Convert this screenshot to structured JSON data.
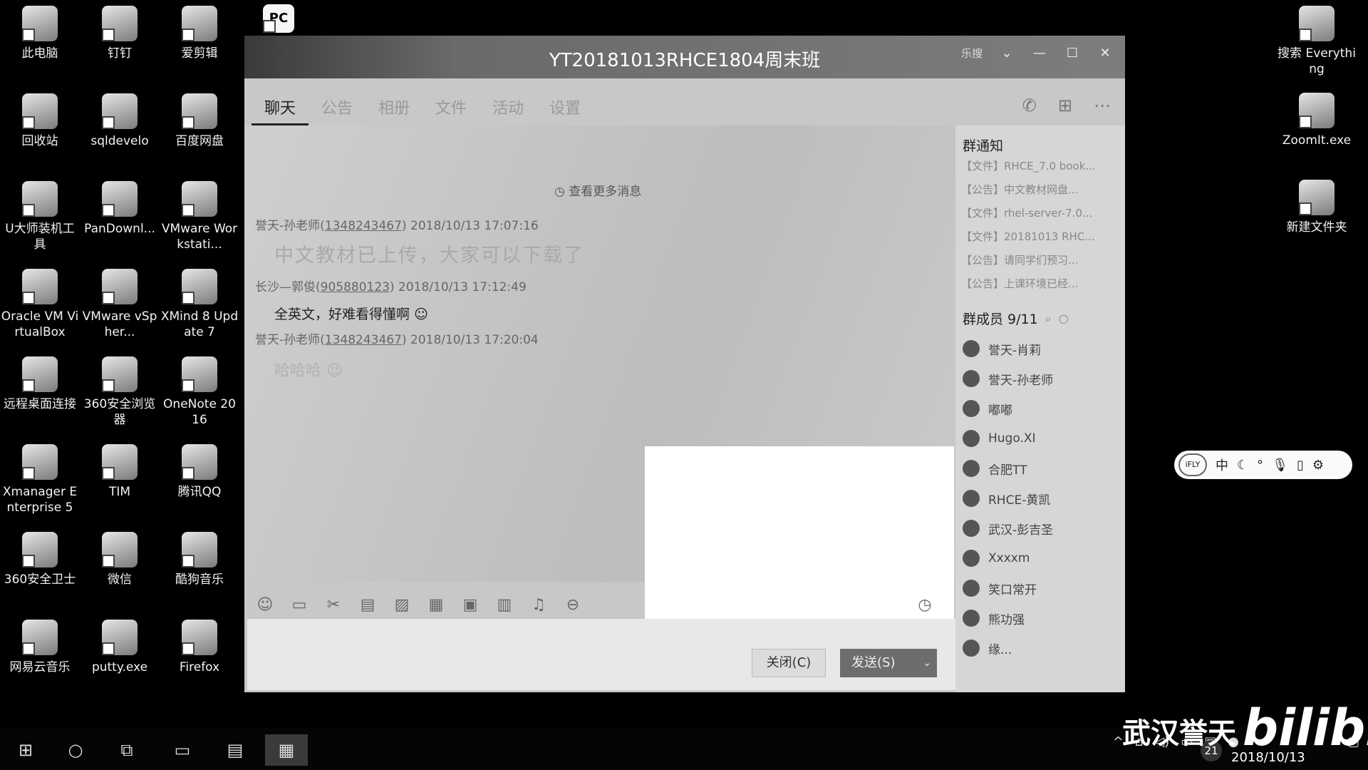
{
  "desktop": {
    "icons": [
      {
        "label": "此电脑",
        "icon": "computer-icon"
      },
      {
        "label": "钉钉",
        "icon": "dingtalk-icon"
      },
      {
        "label": "爱剪辑",
        "icon": "video-editor-icon"
      },
      {
        "label": "回收站",
        "icon": "recycle-bin-icon"
      },
      {
        "label": "sqldevelo",
        "icon": "sqldeveloper-icon"
      },
      {
        "label": "百度网盘",
        "icon": "baidu-netdisk-icon"
      },
      {
        "label": "U大师装机工具",
        "icon": "usb-tool-icon"
      },
      {
        "label": "PanDownl...",
        "icon": "pandownload-icon"
      },
      {
        "label": "VMware Workstati...",
        "icon": "vmware-icon"
      },
      {
        "label": "Oracle VM VirtualBox",
        "icon": "virtualbox-icon"
      },
      {
        "label": "VMware vSpher...",
        "icon": "vsphere-icon"
      },
      {
        "label": "XMind 8 Update 7",
        "icon": "xmind-icon"
      },
      {
        "label": "远程桌面连接",
        "icon": "remote-desktop-icon"
      },
      {
        "label": "360安全浏览器",
        "icon": "360-browser-icon"
      },
      {
        "label": "OneNote 2016",
        "icon": "onenote-icon"
      },
      {
        "label": "Xmanager Enterprise 5",
        "icon": "xmanager-icon"
      },
      {
        "label": "TIM",
        "icon": "tim-icon"
      },
      {
        "label": "腾讯QQ",
        "icon": "qq-icon"
      },
      {
        "label": "360安全卫士",
        "icon": "360-guard-icon"
      },
      {
        "label": "微信",
        "icon": "wechat-icon"
      },
      {
        "label": "酷狗音乐",
        "icon": "kugou-icon"
      },
      {
        "label": "网易云音乐",
        "icon": "netease-music-icon"
      },
      {
        "label": "putty.exe",
        "icon": "putty-icon"
      },
      {
        "label": "Firefox",
        "icon": "firefox-icon"
      }
    ],
    "right_icons": [
      {
        "label": "搜索 Everything",
        "icon": "search-everything-icon"
      },
      {
        "label": "ZoomIt.exe",
        "icon": "zoomit-icon"
      },
      {
        "label": "新建文件夹",
        "icon": "folder-icon"
      }
    ],
    "pc_badge": "PC"
  },
  "window": {
    "title": "YT20181013RHCE1804周末班",
    "title_extra": "乐搜",
    "tabs": [
      "聊天",
      "公告",
      "相册",
      "文件",
      "活动",
      "设置"
    ],
    "more_messages": "查看更多消息",
    "messages": [
      {
        "sender": "誉天-孙老师(",
        "qq": "1348243467",
        "close": ")",
        "time": " 2018/10/13 17:07:16",
        "text": "中文教材已上传，大家可以下载了"
      },
      {
        "sender": "长沙—郭俊(",
        "qq": "905880123",
        "close": ")",
        "time": " 2018/10/13 17:12:49",
        "text": "全英文，好难看得懂啊"
      },
      {
        "sender": "誉天-孙老师(",
        "qq": "1348243467",
        "close": ")",
        "time": " 2018/10/13 17:20:04",
        "text": "哈哈哈"
      }
    ],
    "close_button": "关闭(C)",
    "send_button": "发送(S)",
    "side": {
      "notice_title": "群通知",
      "notices": [
        "【文件】RHCE_7.0 book...",
        "【公告】中文教材网盘...",
        "【文件】rhel-server-7.0...",
        "【文件】20181013 RHC...",
        "【公告】请同学们预习...",
        "【公告】上课环境已经..."
      ],
      "members_title": "群成员 9",
      "members_count": "/11",
      "members": [
        "誉天-肖莉",
        "誉天-孙老师",
        "嘟嘟",
        "Hugo.XI",
        "合肥TT",
        "RHCE-黄凯",
        "武汉-彭吉圣",
        "Xxxxm",
        "笑口常开",
        "熊功强",
        "缘..."
      ]
    }
  },
  "ime": {
    "logo": "iFLY",
    "mode": "中"
  },
  "watermark": {
    "text": "武汉誉天",
    "brand": "bilibili"
  },
  "clock": {
    "date": "2018/10/13",
    "badge": "21"
  }
}
